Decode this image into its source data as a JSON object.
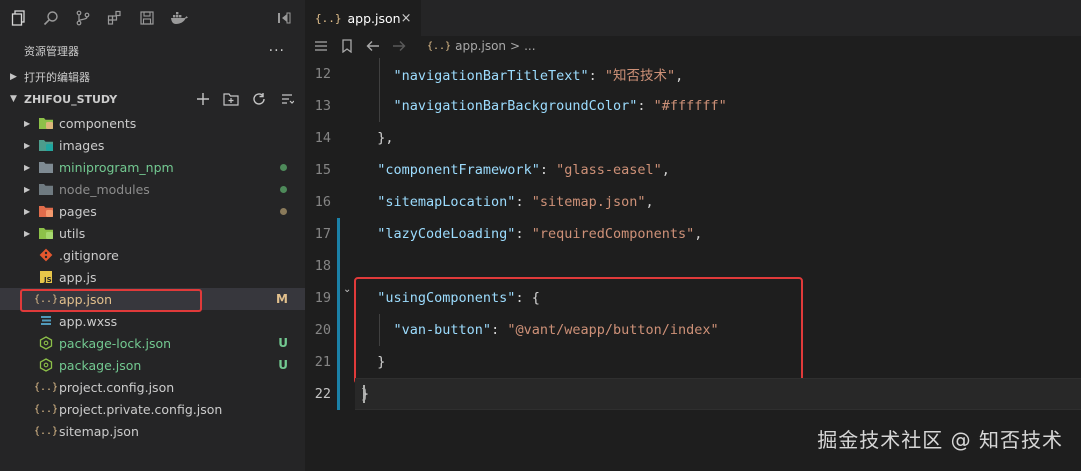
{
  "explorer": {
    "title": "资源管理器",
    "more": "···",
    "open_editors": "打开的编辑器",
    "project": "ZHIFOU_STUDY"
  },
  "tree": [
    {
      "label": "components",
      "type": "folder",
      "icon": "folder-components-icon",
      "color": "#cccccc"
    },
    {
      "label": "images",
      "type": "folder",
      "icon": "folder-images-icon",
      "color": "#cccccc"
    },
    {
      "label": "miniprogram_npm",
      "type": "folder",
      "icon": "folder-npm-icon",
      "color": "#73c991",
      "dot": "#4e8a5a"
    },
    {
      "label": "node_modules",
      "type": "folder",
      "icon": "folder-node-icon",
      "color": "#8c8c8c",
      "dot": "#4e8a5a"
    },
    {
      "label": "pages",
      "type": "folder",
      "icon": "folder-pages-icon",
      "color": "#cccccc",
      "dot": "#8a7a5a"
    },
    {
      "label": "utils",
      "type": "folder",
      "icon": "folder-utils-icon",
      "color": "#cccccc"
    },
    {
      "label": ".gitignore",
      "type": "file",
      "icon": "git-icon",
      "color": "#cccccc"
    },
    {
      "label": "app.js",
      "type": "file",
      "icon": "js-icon",
      "color": "#cccccc"
    },
    {
      "label": "app.json",
      "type": "file",
      "icon": "json-icon",
      "color": "#e2c08d",
      "status": "M",
      "status_color": "#e2c08d",
      "selected": true
    },
    {
      "label": "app.wxss",
      "type": "file",
      "icon": "css-icon",
      "color": "#cccccc"
    },
    {
      "label": "package-lock.json",
      "type": "file",
      "icon": "npm-json-icon",
      "color": "#73c991",
      "status": "U",
      "status_color": "#73c991"
    },
    {
      "label": "package.json",
      "type": "file",
      "icon": "npm-json-icon",
      "color": "#73c991",
      "status": "U",
      "status_color": "#73c991"
    },
    {
      "label": "project.config.json",
      "type": "file",
      "icon": "json-icon",
      "color": "#cccccc"
    },
    {
      "label": "project.private.config.json",
      "type": "file",
      "icon": "json-icon",
      "color": "#cccccc"
    },
    {
      "label": "sitemap.json",
      "type": "file",
      "icon": "json-icon",
      "color": "#cccccc"
    }
  ],
  "tab": {
    "icon_text": "{..}",
    "label": "app.json",
    "close": "×"
  },
  "breadcrumb": {
    "icon_text": "{..}",
    "file": "app.json",
    "sep": ">",
    "rest": "..."
  },
  "code": [
    {
      "n": "12",
      "tokens": [
        [
          "p",
          "    "
        ],
        [
          "k",
          "\"navigationBarTitleText\""
        ],
        [
          "p",
          ": "
        ],
        [
          "s",
          "\"知否技术\""
        ],
        [
          "p",
          ","
        ]
      ]
    },
    {
      "n": "13",
      "tokens": [
        [
          "p",
          "    "
        ],
        [
          "k",
          "\"navigationBarBackgroundColor\""
        ],
        [
          "p",
          ": "
        ],
        [
          "s",
          "\"#ffffff\""
        ]
      ]
    },
    {
      "n": "14",
      "tokens": [
        [
          "p",
          "  "
        ],
        [
          "p",
          "},"
        ]
      ]
    },
    {
      "n": "15",
      "tokens": [
        [
          "p",
          "  "
        ],
        [
          "k",
          "\"componentFramework\""
        ],
        [
          "p",
          ": "
        ],
        [
          "s",
          "\"glass-easel\""
        ],
        [
          "p",
          ","
        ]
      ]
    },
    {
      "n": "16",
      "tokens": [
        [
          "p",
          "  "
        ],
        [
          "k",
          "\"sitemapLocation\""
        ],
        [
          "p",
          ": "
        ],
        [
          "s",
          "\"sitemap.json\""
        ],
        [
          "p",
          ","
        ]
      ]
    },
    {
      "n": "17",
      "tokens": [
        [
          "p",
          "  "
        ],
        [
          "k",
          "\"lazyCodeLoading\""
        ],
        [
          "p",
          ": "
        ],
        [
          "s",
          "\"requiredComponents\""
        ],
        [
          "p",
          ","
        ]
      ]
    },
    {
      "n": "18",
      "tokens": []
    },
    {
      "n": "19",
      "tokens": [
        [
          "p",
          "  "
        ],
        [
          "k",
          "\"usingComponents\""
        ],
        [
          "p",
          ": {"
        ]
      ]
    },
    {
      "n": "20",
      "tokens": [
        [
          "p",
          "    "
        ],
        [
          "k",
          "\"van-button\""
        ],
        [
          "p",
          ": "
        ],
        [
          "s",
          "\"@vant/weapp/button/index\""
        ]
      ]
    },
    {
      "n": "21",
      "tokens": [
        [
          "p",
          "  "
        ],
        [
          "p",
          "}"
        ]
      ]
    },
    {
      "n": "22",
      "tokens": [
        [
          "p",
          "}"
        ]
      ],
      "active": true
    }
  ],
  "watermark": "掘金技术社区 @ 知否技术"
}
